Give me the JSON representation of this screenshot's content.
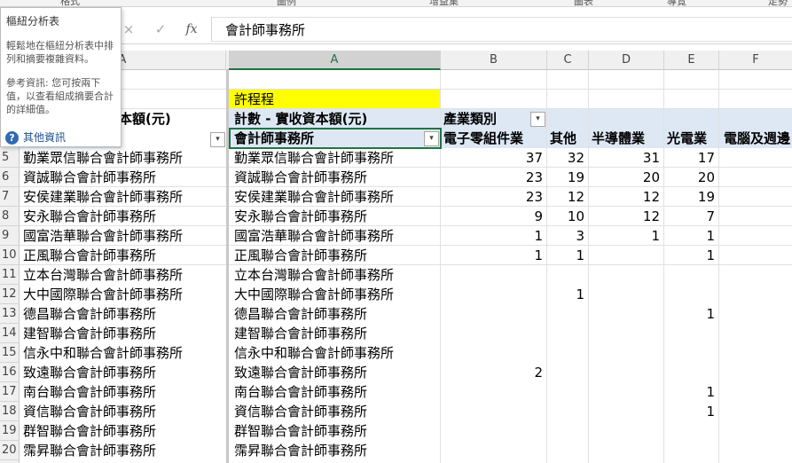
{
  "ribbon": {
    "tabs": [
      "格式",
      "圖例",
      "增益集",
      "圖表",
      "導覽",
      "走勢"
    ]
  },
  "formula_bar": {
    "cancel_icon": "×",
    "enter_icon": "✓",
    "fx_label": "fx",
    "content": "會計師事務所"
  },
  "column_headers": [
    "A",
    "A",
    "B",
    "C",
    "D",
    "E",
    "F"
  ],
  "row_numbers": [
    "5",
    "6",
    "7",
    "8",
    "9",
    "10",
    "11",
    "12",
    "13",
    "14",
    "15",
    "16",
    "17",
    "18",
    "19",
    "20"
  ],
  "left_pane": {
    "header_fragment": "本額(元)",
    "names": [
      "勤業眾信聯合會計師事務所",
      "資誠聯合會計師事務所",
      "安侯建業聯合會計師事務所",
      "安永聯合會計師事務所",
      "國富浩華聯合會計師事務所",
      "正風聯合會計師事務所",
      "立本台灣聯合會計師事務所",
      "大中國際聯合會計師事務所",
      "德昌聯合會計師事務所",
      "建智聯合會計師事務所",
      "信永中和聯合會計師事務所",
      "致遠聯合會計師事務所",
      "南台聯合會計師事務所",
      "資信聯合會計師事務所",
      "群智聯合會計師事務所",
      "霈昇聯合會計師事務所"
    ]
  },
  "pivot": {
    "filter_value": "許程程",
    "value_label": "計數 - 實收資本額(元)",
    "column_field": "產業類別",
    "row_field": "會計師事務所",
    "categories": [
      "電子零組件業",
      "其他",
      "半導體業",
      "光電業",
      "電腦及週邊"
    ],
    "rows": [
      {
        "name": "勤業眾信聯合會計師事務所",
        "values": [
          "37",
          "32",
          "31",
          "17"
        ]
      },
      {
        "name": "資誠聯合會計師事務所",
        "values": [
          "23",
          "19",
          "20",
          "20"
        ]
      },
      {
        "name": "安侯建業聯合會計師事務所",
        "values": [
          "23",
          "12",
          "12",
          "19"
        ]
      },
      {
        "name": "安永聯合會計師事務所",
        "values": [
          "9",
          "10",
          "12",
          "7"
        ]
      },
      {
        "name": "國富浩華聯合會計師事務所",
        "values": [
          "1",
          "3",
          "1",
          "1"
        ]
      },
      {
        "name": "正風聯合會計師事務所",
        "values": [
          "1",
          "1",
          "",
          "1"
        ]
      },
      {
        "name": "立本台灣聯合會計師事務所",
        "values": [
          "",
          "",
          "",
          ""
        ]
      },
      {
        "name": "大中國際聯合會計師事務所",
        "values": [
          "",
          "1",
          "",
          ""
        ]
      },
      {
        "name": "德昌聯合會計師事務所",
        "values": [
          "",
          "",
          "",
          "1"
        ]
      },
      {
        "name": "建智聯合會計師事務所",
        "values": [
          "",
          "",
          "",
          ""
        ]
      },
      {
        "name": "信永中和聯合會計師事務所",
        "values": [
          "",
          "",
          "",
          ""
        ]
      },
      {
        "name": "致遠聯合會計師事務所",
        "values": [
          "2",
          "",
          "",
          ""
        ]
      },
      {
        "name": "南台聯合會計師事務所",
        "values": [
          "",
          "",
          "",
          "1"
        ]
      },
      {
        "name": "資信聯合會計師事務所",
        "values": [
          "",
          "",
          "",
          "1"
        ]
      },
      {
        "name": "群智聯合會計師事務所",
        "values": [
          "",
          "",
          "",
          ""
        ]
      },
      {
        "name": "霈昇聯合會計師事務所",
        "values": [
          "",
          "",
          "",
          ""
        ]
      }
    ]
  },
  "tooltip": {
    "title": "樞紐分析表",
    "description": "輕鬆地在樞紐分析表中排列和摘要複雜資料。",
    "reference": "參考資訊: 您可按兩下值，以查看組成摘要合計的詳細值。",
    "link_label": "其他資訊",
    "help_icon": "?"
  },
  "colors": {
    "accent": "#217346",
    "filter_fill": "#ffff00",
    "header_band": "#dde8f4",
    "link": "#1e4e8c"
  }
}
